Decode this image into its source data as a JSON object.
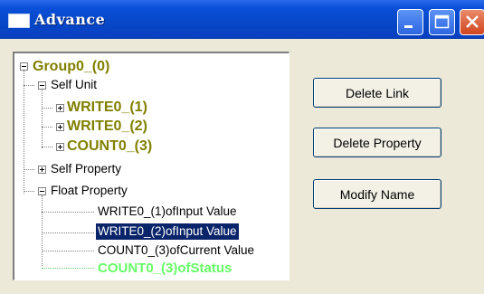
{
  "window": {
    "title": "Advance"
  },
  "tree": {
    "root": "Group0_(0)",
    "self_unit": "Self Unit",
    "write1": "WRITE0_(1)",
    "write2": "WRITE0_(2)",
    "count3": "COUNT0_(3)",
    "self_property": "Self Property",
    "float_property": "Float Property",
    "leaf1": "WRITE0_(1)ofInput Value",
    "leaf2": "WRITE0_(2)ofInput Value",
    "leaf3": "COUNT0_(3)ofCurrent Value",
    "leaf4": "COUNT0_(3)ofStatus"
  },
  "buttons": {
    "delete_link": "Delete Link",
    "delete_property": "Delete Property",
    "modify_name": "Modify Name"
  }
}
